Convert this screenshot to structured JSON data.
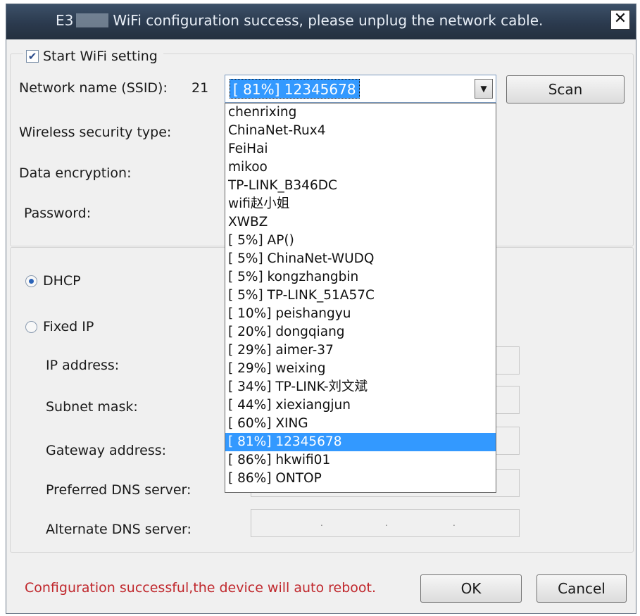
{
  "titlebar": {
    "title_prefix": "E3",
    "title_suffix": "WiFi configuration success, please unplug the network cable.",
    "close_label": "✕"
  },
  "wifi": {
    "start_label": "Start WiFi setting",
    "start_checked": true,
    "ssid_label": "Network name (SSID):",
    "ssid_count": "21",
    "ssid_value": "[ 81%] 12345678",
    "scan_label": "Scan",
    "security_label": "Wireless security type:",
    "encryption_label": "Data encryption:",
    "password_label": "Password:"
  },
  "dropdown_options": [
    "chenrixing",
    "ChinaNet-Rux4",
    "FeiHai",
    "mikoo",
    "TP-LINK_B346DC",
    "wifi赵小姐",
    "XWBZ",
    "[  5%] AP()",
    "[  5%] ChinaNet-WUDQ",
    "[  5%] kongzhangbin",
    "[  5%] TP-LINK_51A57C",
    "[ 10%] peishangyu",
    "[ 20%] dongqiang",
    "[ 29%] aimer-37",
    "[ 29%] weixing",
    "[ 34%] TP-LINK-刘文斌",
    "[ 44%] xiexiangjun",
    "[ 60%] XING",
    "[ 81%] 12345678",
    "[ 86%] hkwifi01",
    "[ 86%] ONTOP"
  ],
  "selected_option_index": 18,
  "ip": {
    "dhcp_label": "DHCP",
    "fixed_label": "Fixed IP",
    "mode": "DHCP",
    "ip_address_label": "IP address:",
    "subnet_label": "Subnet mask:",
    "gateway_label": "Gateway address:",
    "dns1_label": "Preferred DNS server:",
    "dns2_label": "Alternate DNS server:",
    "ip_dot": "."
  },
  "footer": {
    "status": "Configuration successful,the device will auto reboot.",
    "ok_label": "OK",
    "cancel_label": "Cancel"
  },
  "colors": {
    "selection": "#3399ff",
    "status_text": "#c0282d",
    "title_bar": "#2b3a4e"
  },
  "icons": {
    "checkbox": "check-mark",
    "dropdown_arrow": "triangle-down",
    "close": "x-mark"
  }
}
